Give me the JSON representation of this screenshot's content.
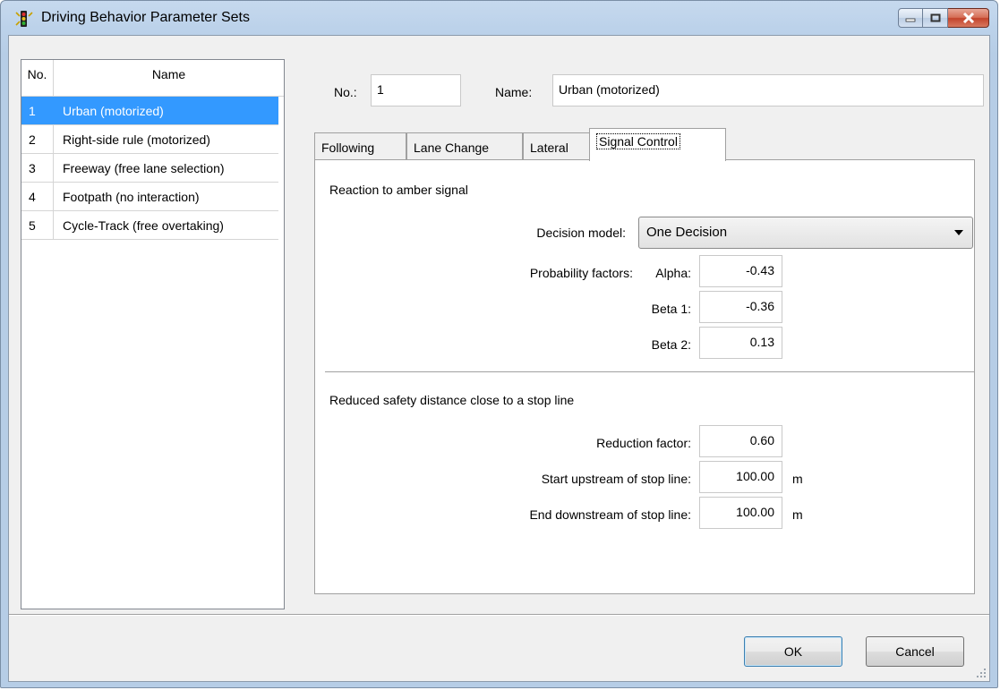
{
  "window": {
    "title": "Driving Behavior Parameter Sets"
  },
  "list": {
    "headers": {
      "no": "No.",
      "name": "Name"
    },
    "rows": [
      {
        "no": "1",
        "name": "Urban (motorized)",
        "selected": true
      },
      {
        "no": "2",
        "name": "Right-side rule (motorized)",
        "selected": false
      },
      {
        "no": "3",
        "name": "Freeway (free lane selection)",
        "selected": false
      },
      {
        "no": "4",
        "name": "Footpath (no interaction)",
        "selected": false
      },
      {
        "no": "5",
        "name": "Cycle-Track (free overtaking)",
        "selected": false
      }
    ]
  },
  "header": {
    "no_label": "No.:",
    "no_value": "1",
    "name_label": "Name:",
    "name_value": "Urban (motorized)"
  },
  "tabs": [
    {
      "label": "Following",
      "active": false
    },
    {
      "label": "Lane Change",
      "active": false
    },
    {
      "label": "Lateral",
      "active": false
    },
    {
      "label": "Signal Control",
      "active": true
    }
  ],
  "signal_control": {
    "amber_section_title": "Reaction to amber signal",
    "decision_model_label": "Decision model:",
    "decision_model_value": "One Decision",
    "probability_factors_label": "Probability factors:",
    "alpha_label": "Alpha:",
    "alpha_value": "-0.43",
    "beta1_label": "Beta 1:",
    "beta1_value": "-0.36",
    "beta2_label": "Beta 2:",
    "beta2_value": "0.13",
    "stopline_section_title": "Reduced safety distance close to a stop line",
    "reduction_factor_label": "Reduction factor:",
    "reduction_factor_value": "0.60",
    "start_upstream_label": "Start upstream of stop line:",
    "start_upstream_value": "100.00",
    "start_upstream_unit": "m",
    "end_downstream_label": "End downstream of stop line:",
    "end_downstream_value": "100.00",
    "end_downstream_unit": "m"
  },
  "footer": {
    "ok_label": "OK",
    "cancel_label": "Cancel"
  }
}
